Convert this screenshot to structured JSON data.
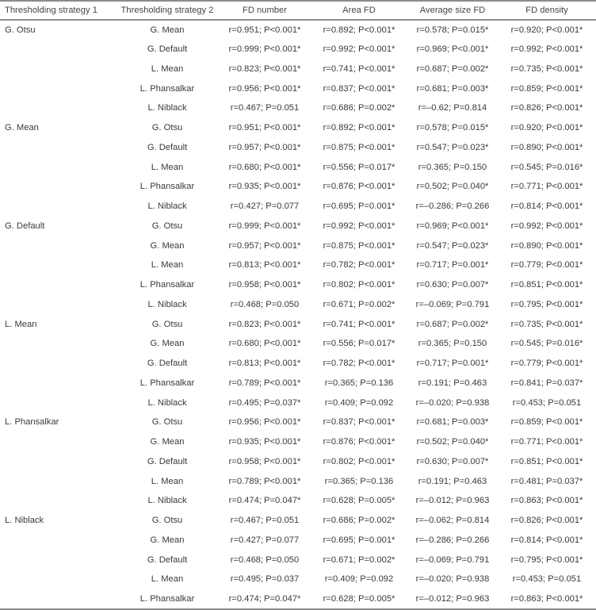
{
  "table": {
    "headers": [
      "Thresholding strategy 1",
      "Thresholding strategy 2",
      "FD number",
      "Area FD",
      "Average size FD",
      "FD density"
    ],
    "rows": [
      [
        "G. Otsu",
        "G. Mean",
        "r=0.951; P<0.001*",
        "r=0.892; P<0.001*",
        "r=0.578; P=0.015*",
        "r=0.920; P<0.001*"
      ],
      [
        "",
        "G. Default",
        "r=0.999; P<0.001*",
        "r=0.992; P<0.001*",
        "r=0.969; P<0.001*",
        "r=0.992; P<0.001*"
      ],
      [
        "",
        "L. Mean",
        "r=0.823; P<0.001*",
        "r=0.741; P<0.001*",
        "r=0.687; P=0.002*",
        "r=0.735; P<0.001*"
      ],
      [
        "",
        "L. Phansalkar",
        "r=0.956; P<0.001*",
        "r=0.837; P<0.001*",
        "r=0.681; P=0.003*",
        "r=0.859; P<0.001*"
      ],
      [
        "",
        "L. Niblack",
        "r=0.467; P=0.051",
        "r=0.686; P=0.002*",
        "r=–0.62; P=0.814",
        "r=0.826; P<0.001*"
      ],
      [
        "G. Mean",
        "G. Otsu",
        "r=0.951; P<0.001*",
        "r=0.892; P<0.001*",
        "r=0.578; P=0.015*",
        "r=0.920; P<0.001*"
      ],
      [
        "",
        "G. Default",
        "r=0.957; P<0.001*",
        "r=0.875; P<0.001*",
        "r=0.547; P=0.023*",
        "r=0.890; P<0.001*"
      ],
      [
        "",
        "L. Mean",
        "r=0.680; P<0.001*",
        "r=0.556; P=0.017*",
        "r=0.365; P=0.150",
        "r=0.545; P=0.016*"
      ],
      [
        "",
        "L. Phansalkar",
        "r=0.935; P<0.001*",
        "r=0.876; P<0.001*",
        "r=0.502; P=0.040*",
        "r=0.771; P<0.001*"
      ],
      [
        "",
        "L. Niblack",
        "r=0.427; P=0.077",
        "r=0.695; P=0.001*",
        "r=–0.286; P=0.266",
        "r=0.814; P<0.001*"
      ],
      [
        "G. Default",
        "G. Otsu",
        "r=0.999; P<0.001*",
        "r=0.992; P<0.001*",
        "r=0.969; P<0.001*",
        "r=0.992; P<0.001*"
      ],
      [
        "",
        "G. Mean",
        "r=0.957; P<0.001*",
        "r=0.875; P<0.001*",
        "r=0.547; P=0.023*",
        "r=0.890; P<0.001*"
      ],
      [
        "",
        "L. Mean",
        "r=0.813; P<0.001*",
        "r=0.782; P<0.001*",
        "r=0.717; P=0.001*",
        "r=0.779; P<0.001*"
      ],
      [
        "",
        "L. Phansalkar",
        "r=0.958; P<0.001*",
        "r=0.802; P<0.001*",
        "r=0.630; P=0.007*",
        "r=0.851; P<0.001*"
      ],
      [
        "",
        "L. Niblack",
        "r=0.468; P=0.050",
        "r=0.671; P=0.002*",
        "r=–0.069; P=0.791",
        "r=0.795; P<0.001*"
      ],
      [
        "L. Mean",
        "G. Otsu",
        "r=0.823; P<0.001*",
        "r=0.741; P<0.001*",
        "r=0.687; P=0.002*",
        "r=0.735; P<0.001*"
      ],
      [
        "",
        "G. Mean",
        "r=0.680; P<0.001*",
        "r=0.556; P=0.017*",
        "r=0.365; P=0.150",
        "r=0.545; P=0.016*"
      ],
      [
        "",
        "G. Default",
        "r=0.813; P<0.001*",
        "r=0.782; P<0.001*",
        "r=0.717; P=0.001*",
        "r=0.779; P<0.001*"
      ],
      [
        "",
        "L. Phansalkar",
        "r=0.789; P<0.001*",
        "r=0.365; P=0.136",
        "r=0.191; P=0.463",
        "r=0.841; P=0.037*"
      ],
      [
        "",
        "L. Niblack",
        "r=0.495; P=0.037*",
        "r=0.409; P=0.092",
        "r=–0.020; P=0.938",
        "r=0.453; P=0.051"
      ],
      [
        "L. Phansalkar",
        "G. Otsu",
        "r=0.956; P<0.001*",
        "r=0.837; P<0.001*",
        "r=0.681; P=0.003*",
        "r=0.859; P<0.001*"
      ],
      [
        "",
        "G. Mean",
        "r=0.935; P<0.001*",
        "r=0.876; P<0.001*",
        "r=0.502; P=0.040*",
        "r=0.771; P<0.001*"
      ],
      [
        "",
        "G. Default",
        "r=0.958; P<0.001*",
        "r=0.802; P<0.001*",
        "r=0.630; P=0.007*",
        "r=0.851; P<0.001*"
      ],
      [
        "",
        "L. Mean",
        "r=0.789; P<0.001*",
        "r=0.365; P=0.136",
        "r=0.191; P=0.463",
        "r=0.481; P=0.037*"
      ],
      [
        "",
        "L. Niblack",
        "r=0.474; P=0.047*",
        "r=0.628; P=0.005*",
        "r=–0.012; P=0.963",
        "r=0.863; P<0.001*"
      ],
      [
        "L. Niblack",
        "G. Otsu",
        "r=0.467; P=0.051",
        "r=0.686; P=0.002*",
        "r=–0.062; P=0.814",
        "r=0.826; P<0.001*"
      ],
      [
        "",
        "G. Mean",
        "r=0.427; P=0.077",
        "r=0.695; P=0.001*",
        "r=–0.286; P=0.266",
        "r=0.814; P<0.001*"
      ],
      [
        "",
        "G. Default",
        "r=0.468; P=0.050",
        "r=0.671; P=0.002*",
        "r=–0.069; P=0.791",
        "r=0.795; P<0.001*"
      ],
      [
        "",
        "L. Mean",
        "r=0.495; P=0.037",
        "r=0.409; P=0.092",
        "r=–0.020; P=0.938",
        "r=0.453; P=0.051"
      ],
      [
        "",
        "L. Phansalkar",
        "r=0.474; P=0.047*",
        "r=0.628; P=0.005*",
        "r=–0.012; P=0.963",
        "r=0.863; P<0.001*"
      ]
    ]
  }
}
